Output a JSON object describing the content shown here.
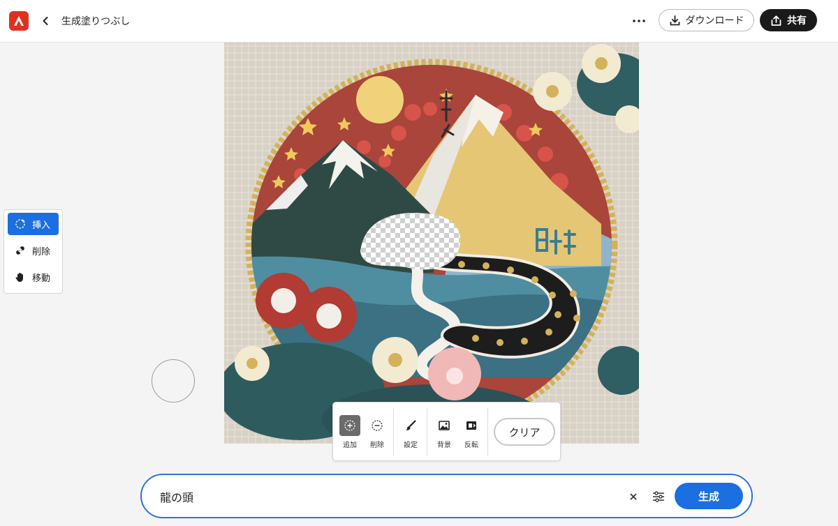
{
  "header": {
    "title": "生成塗りつぶし",
    "download_label": "ダウンロード",
    "share_label": "共有"
  },
  "tool_panel": {
    "items": [
      {
        "label": "挿入",
        "icon": "sparkle-add-icon",
        "active": true
      },
      {
        "label": "削除",
        "icon": "bandage-icon",
        "active": false
      },
      {
        "label": "移動",
        "icon": "hand-icon",
        "active": false
      }
    ]
  },
  "selection_toolbar": {
    "add_label": "追加",
    "remove_label": "削除",
    "settings_label": "設定",
    "background_label": "背景",
    "invert_label": "反転",
    "clear_label": "クリア"
  },
  "prompt": {
    "value": "龍の頭",
    "generate_label": "生成"
  },
  "colors": {
    "accent": "#1b6fe0",
    "brand_red": "#e0311f",
    "share_bg": "#1a1a1a",
    "prompt_border": "#2c73db"
  }
}
